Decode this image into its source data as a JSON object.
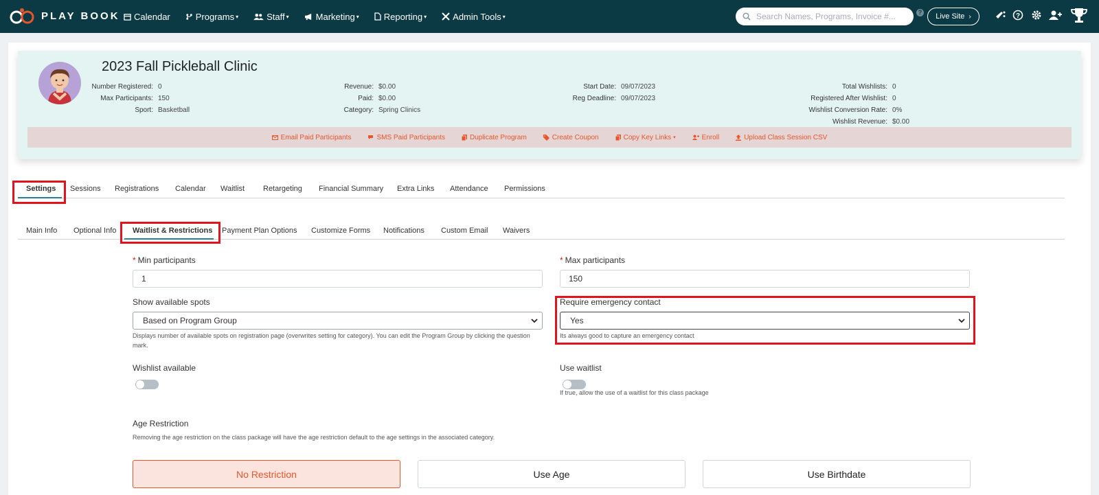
{
  "brand": {
    "name_prefix": "",
    "name": "PLAY BOOK",
    "accent_color": "#e8552b",
    "nav_color": "#0c3a44"
  },
  "nav": {
    "items": [
      {
        "label": "Calendar",
        "icon": "calendar-icon",
        "caret": false
      },
      {
        "label": "Programs",
        "icon": "programs-icon",
        "caret": true
      },
      {
        "label": "Staff",
        "icon": "staff-icon",
        "caret": true
      },
      {
        "label": "Marketing",
        "icon": "megaphone-icon",
        "caret": true
      },
      {
        "label": "Reporting",
        "icon": "document-icon",
        "caret": true
      },
      {
        "label": "Admin Tools",
        "icon": "tools-icon",
        "caret": true
      }
    ],
    "search_placeholder": "Search Names, Programs, Invoice #...",
    "live_site_label": "Live Site"
  },
  "program": {
    "title": "2023 Fall Pickleball Clinic",
    "stats_col1": [
      {
        "label": "Number Registered:",
        "value": "0"
      },
      {
        "label": "Max Participants:",
        "value": "150"
      },
      {
        "label": "Sport:",
        "value": "Basketball"
      }
    ],
    "stats_col2": [
      {
        "label": "Revenue:",
        "value": "$0.00"
      },
      {
        "label": "Paid:",
        "value": "$0.00"
      },
      {
        "label": "Category:",
        "value": "Spring Clinics"
      }
    ],
    "stats_col3": [
      {
        "label": "Start Date:",
        "value": "09/07/2023"
      },
      {
        "label": "Reg Deadline:",
        "value": "09/07/2023"
      }
    ],
    "stats_col4": [
      {
        "label": "Total Wishlists:",
        "value": "0"
      },
      {
        "label": "Registered After Wishlist:",
        "value": "0"
      },
      {
        "label": "Wishlist Conversion Rate:",
        "value": "0%"
      },
      {
        "label": "Wishlist Revenue:",
        "value": "$0.00"
      }
    ],
    "actions": [
      "Email Paid Participants",
      "SMS Paid Participants",
      "Duplicate Program",
      "Create Coupon",
      "Copy Key Links",
      "Enroll",
      "Upload Class Session CSV"
    ]
  },
  "main_tabs": [
    "Settings",
    "Sessions",
    "Registrations",
    "Calendar",
    "Waitlist",
    "Retargeting",
    "Financial Summary",
    "Extra Links",
    "Attendance",
    "Permissions"
  ],
  "sub_tabs": [
    "Main Info",
    "Optional Info",
    "Waitlist & Restrictions",
    "Payment Plan Options",
    "Customize Forms",
    "Notifications",
    "Custom Email",
    "Waivers"
  ],
  "form": {
    "min_label": "Min participants",
    "min_value": "1",
    "max_label": "Max participants",
    "max_value": "150",
    "show_spots_label": "Show available spots",
    "show_spots_value": "Based on Program Group",
    "show_spots_help": "Displays number of available spots on registration page (overwrites setting for category). You can edit the Program Group by clicking the question mark.",
    "emergency_label": "Require emergency contact",
    "emergency_value": "Yes",
    "emergency_help": "Its always good to capture an emergency contact",
    "wishlist_label": "Wishlist available",
    "waitlist_label": "Use waitlist",
    "waitlist_help": "If true, allow the use of a waitlist for this class package",
    "age_label": "Age Restriction",
    "age_help": "Removing the age restriction on the class package will have the age restriction default to the age settings in the associated category.",
    "age_options": [
      "No Restriction",
      "Use Age",
      "Use Birthdate"
    ]
  }
}
